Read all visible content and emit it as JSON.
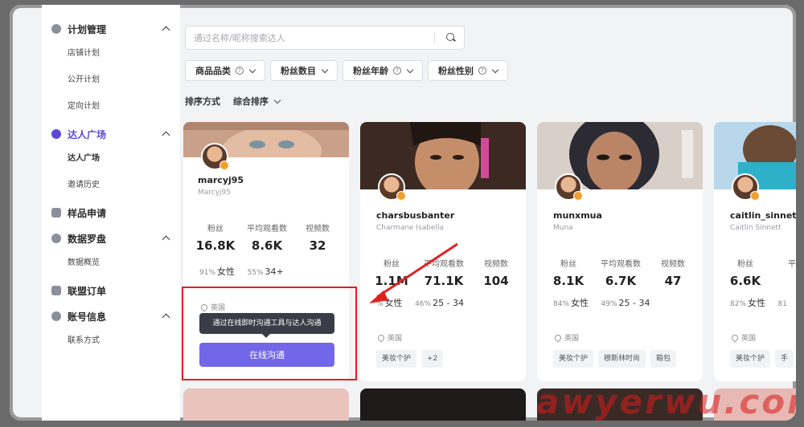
{
  "sidebar": {
    "sections": [
      {
        "label": "计划管理",
        "items": [
          "店铺计划",
          "公开计划",
          "定向计划"
        ]
      },
      {
        "label": "达人广场",
        "items": [
          "达人广场",
          "邀请历史"
        ]
      },
      {
        "label": "样品申请",
        "items": []
      },
      {
        "label": "数据罗盘",
        "items": [
          "数据概览"
        ]
      },
      {
        "label": "联盟订单",
        "items": []
      },
      {
        "label": "账号信息",
        "items": [
          "联系方式"
        ]
      }
    ]
  },
  "search": {
    "placeholder": "通过名称/昵称搜索达人"
  },
  "filters": [
    "商品品类",
    "粉丝数目",
    "粉丝年龄",
    "粉丝性别"
  ],
  "sort": {
    "label": "排序方式",
    "value": "综合排序"
  },
  "stat_labels": {
    "fans": "粉丝",
    "avg_views": "平均观看数",
    "videos": "视频数"
  },
  "gender_female": "女性",
  "cards": [
    {
      "username": "marcyj95",
      "display": "Marcyj95",
      "fans": "16.8K",
      "avg": "8.6K",
      "videos": "32",
      "female_pct": "91%",
      "age_pct": "55%",
      "age": "34+",
      "location": "英国",
      "tags": []
    },
    {
      "username": "charsbusbanter",
      "display": "Charmane Isabella",
      "fans": "1.1M",
      "avg": "71.1K",
      "videos": "104",
      "female_pct": "%",
      "age_pct": "46%",
      "age": "25 - 34",
      "location": "英国",
      "tags": [
        "美妆个护",
        "+2"
      ]
    },
    {
      "username": "munxmua",
      "display": "Muna",
      "fans": "8.1K",
      "avg": "6.7K",
      "videos": "47",
      "female_pct": "84%",
      "age_pct": "49%",
      "age": "25 - 34",
      "location": "英国",
      "tags": [
        "美妆个护",
        "穆斯林时尚",
        "箱包"
      ]
    },
    {
      "username": "caitlin_sinnett",
      "display": "Caitlin Sinnett",
      "fans": "6.6K",
      "avg": "平",
      "videos": "",
      "female_pct": "82%",
      "age_pct": "81",
      "age": "",
      "location": "英国",
      "tags": [
        "美妆个护",
        "手"
      ]
    }
  ],
  "tooltip": "通过在线即时沟通工具与达人沟通",
  "chat_button": "在线沟通",
  "watermark": "awyerwu.com",
  "colors": {
    "accent": "#5b48d9",
    "button": "#7267e8",
    "highlight": "#e02020"
  }
}
